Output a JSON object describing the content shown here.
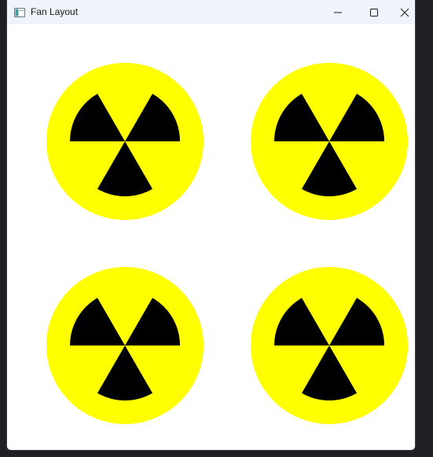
{
  "window": {
    "title": "Fan Layout",
    "app_icon": "window-app-icon",
    "controls": {
      "minimize_icon": "minimize-icon",
      "maximize_icon": "maximize-icon",
      "close_icon": "close-icon"
    }
  },
  "content": {
    "fans": [
      {
        "icon": "radiation-symbol-icon"
      },
      {
        "icon": "radiation-symbol-icon"
      },
      {
        "icon": "radiation-symbol-icon"
      },
      {
        "icon": "radiation-symbol-icon"
      }
    ],
    "colors": {
      "circle": "#ffff00",
      "blades": "#000000",
      "background": "#ffffff"
    }
  }
}
